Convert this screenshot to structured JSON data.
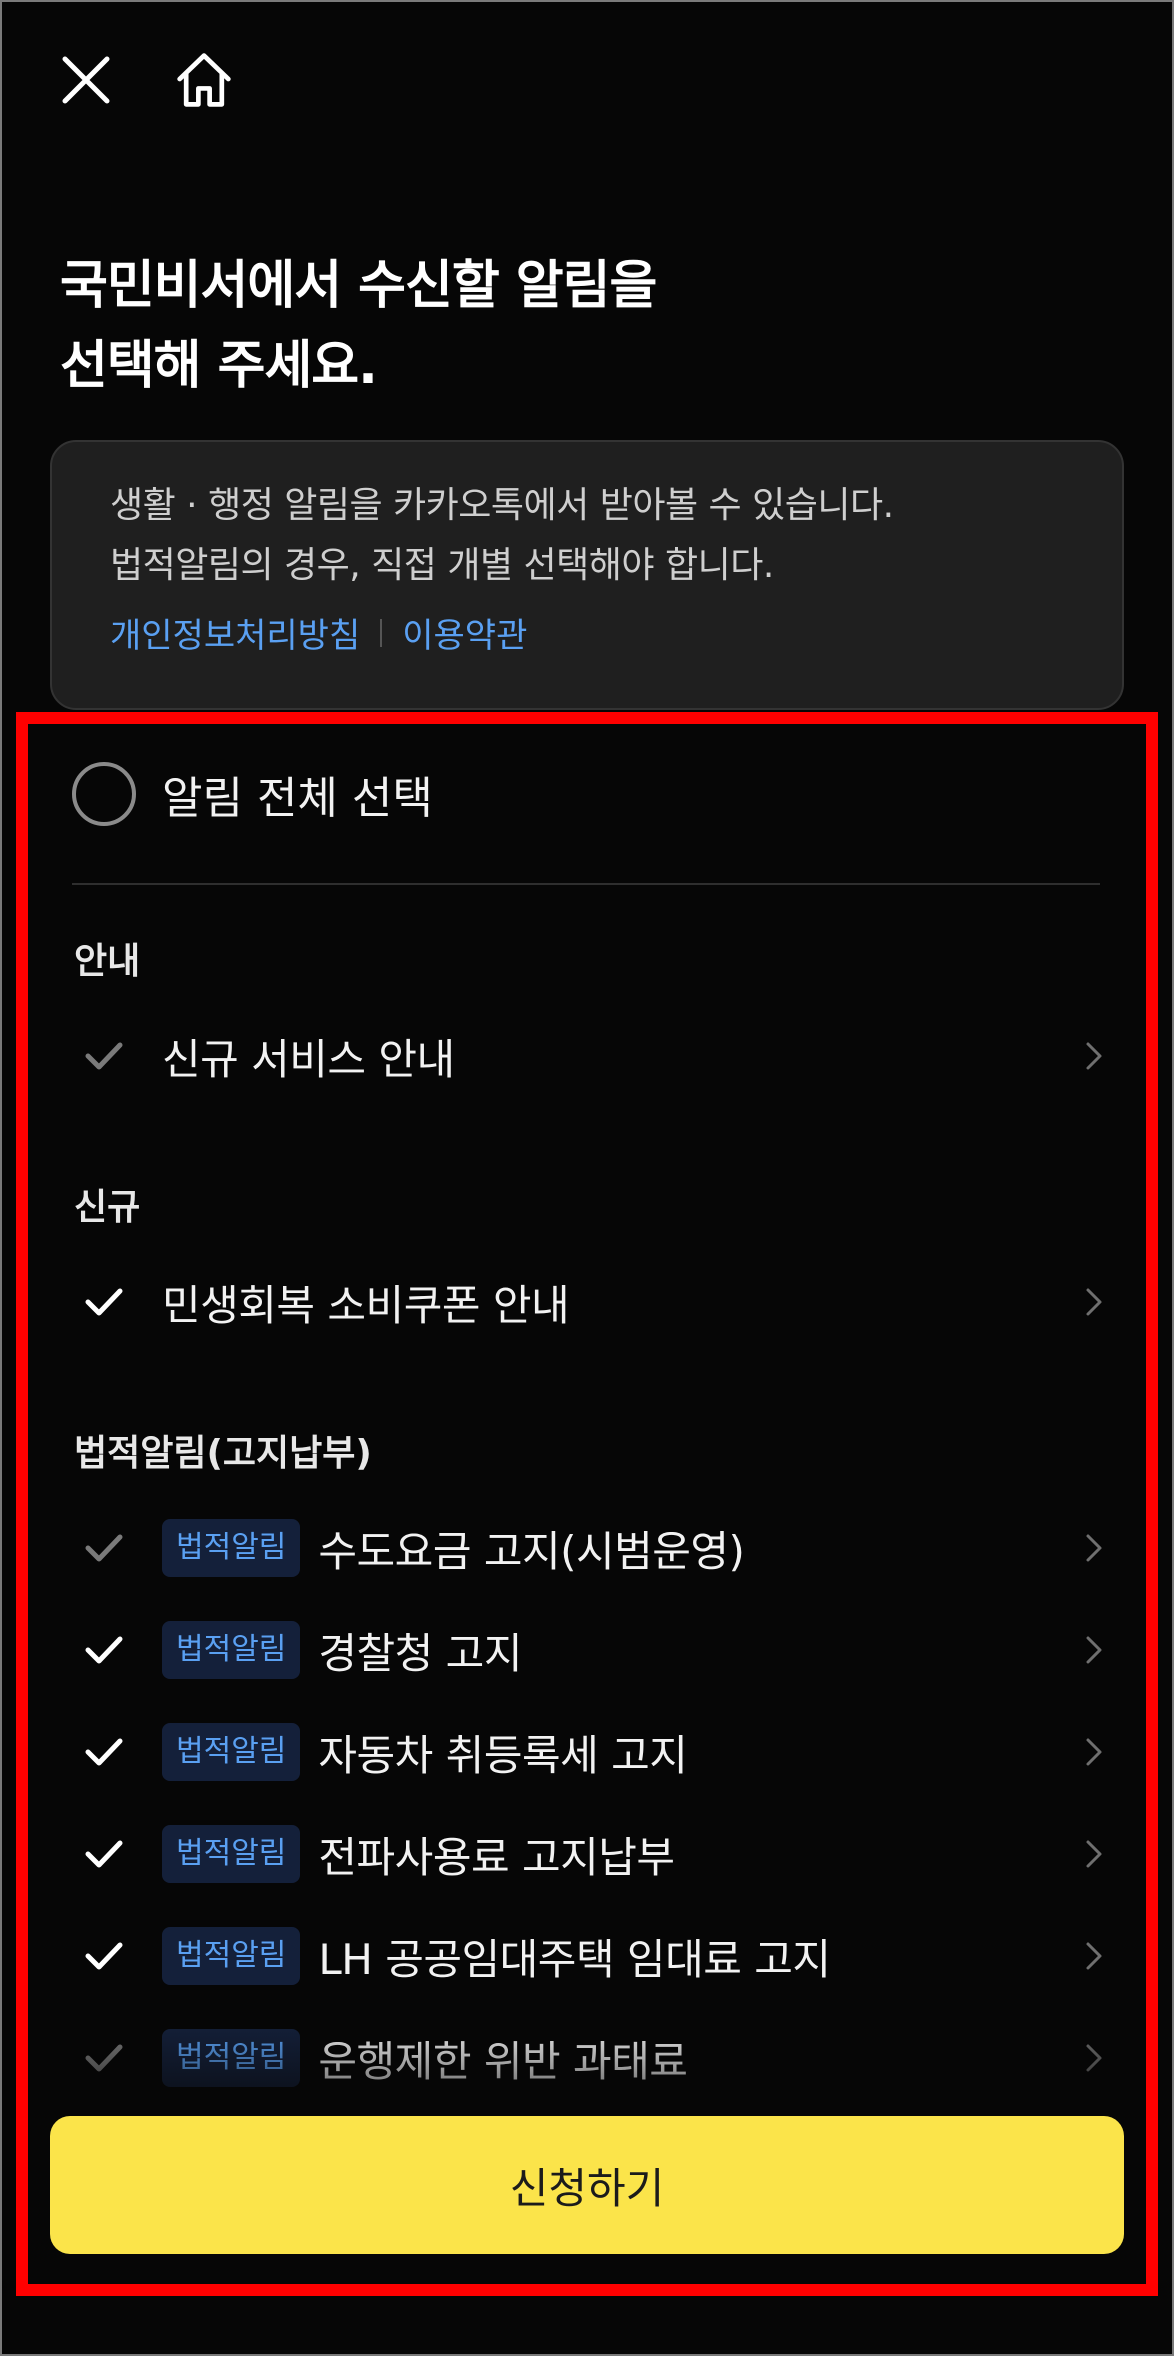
{
  "nav": {
    "close_icon": "close-icon",
    "home_icon": "home-icon"
  },
  "headline": {
    "line1": "국민비서에서 수신할 알림을",
    "line2": "선택해 주세요."
  },
  "info": {
    "line1": "생활 · 행정 알림을 카카오톡에서 받아볼 수 있습니다.",
    "line2": "법적알림의 경우, 직접 개별 선택해야 합니다.",
    "privacy_link": "개인정보처리방침",
    "terms_link": "이용약관"
  },
  "select_all": {
    "label": "알림 전체 선택",
    "checked": false
  },
  "sections": [
    {
      "title": "안내",
      "items": [
        {
          "label": "신규 서비스 안내",
          "checked": false
        }
      ]
    },
    {
      "title": "신규",
      "items": [
        {
          "label": "민생회복 소비쿠폰 안내",
          "checked": true
        }
      ]
    },
    {
      "title": "법적알림(고지납부)",
      "items": [
        {
          "badge": "법적알림",
          "label": "수도요금 고지(시범운영)",
          "checked": false
        },
        {
          "badge": "법적알림",
          "label": "경찰청 고지",
          "checked": true
        },
        {
          "badge": "법적알림",
          "label": "자동차 취등록세 고지",
          "checked": true
        },
        {
          "badge": "법적알림",
          "label": "전파사용료 고지납부",
          "checked": true
        },
        {
          "badge": "법적알림",
          "label": "LH 공공임대주택 임대료 고지",
          "checked": true
        },
        {
          "badge": "법적알림",
          "label": "운행제한 위반 과태료",
          "checked": false
        }
      ]
    }
  ],
  "cta": {
    "label": "신청하기"
  },
  "colors": {
    "background": "#060606",
    "accent_link": "#5aa0f2",
    "cta": "#fbe44a",
    "highlight": "#ff0000"
  }
}
